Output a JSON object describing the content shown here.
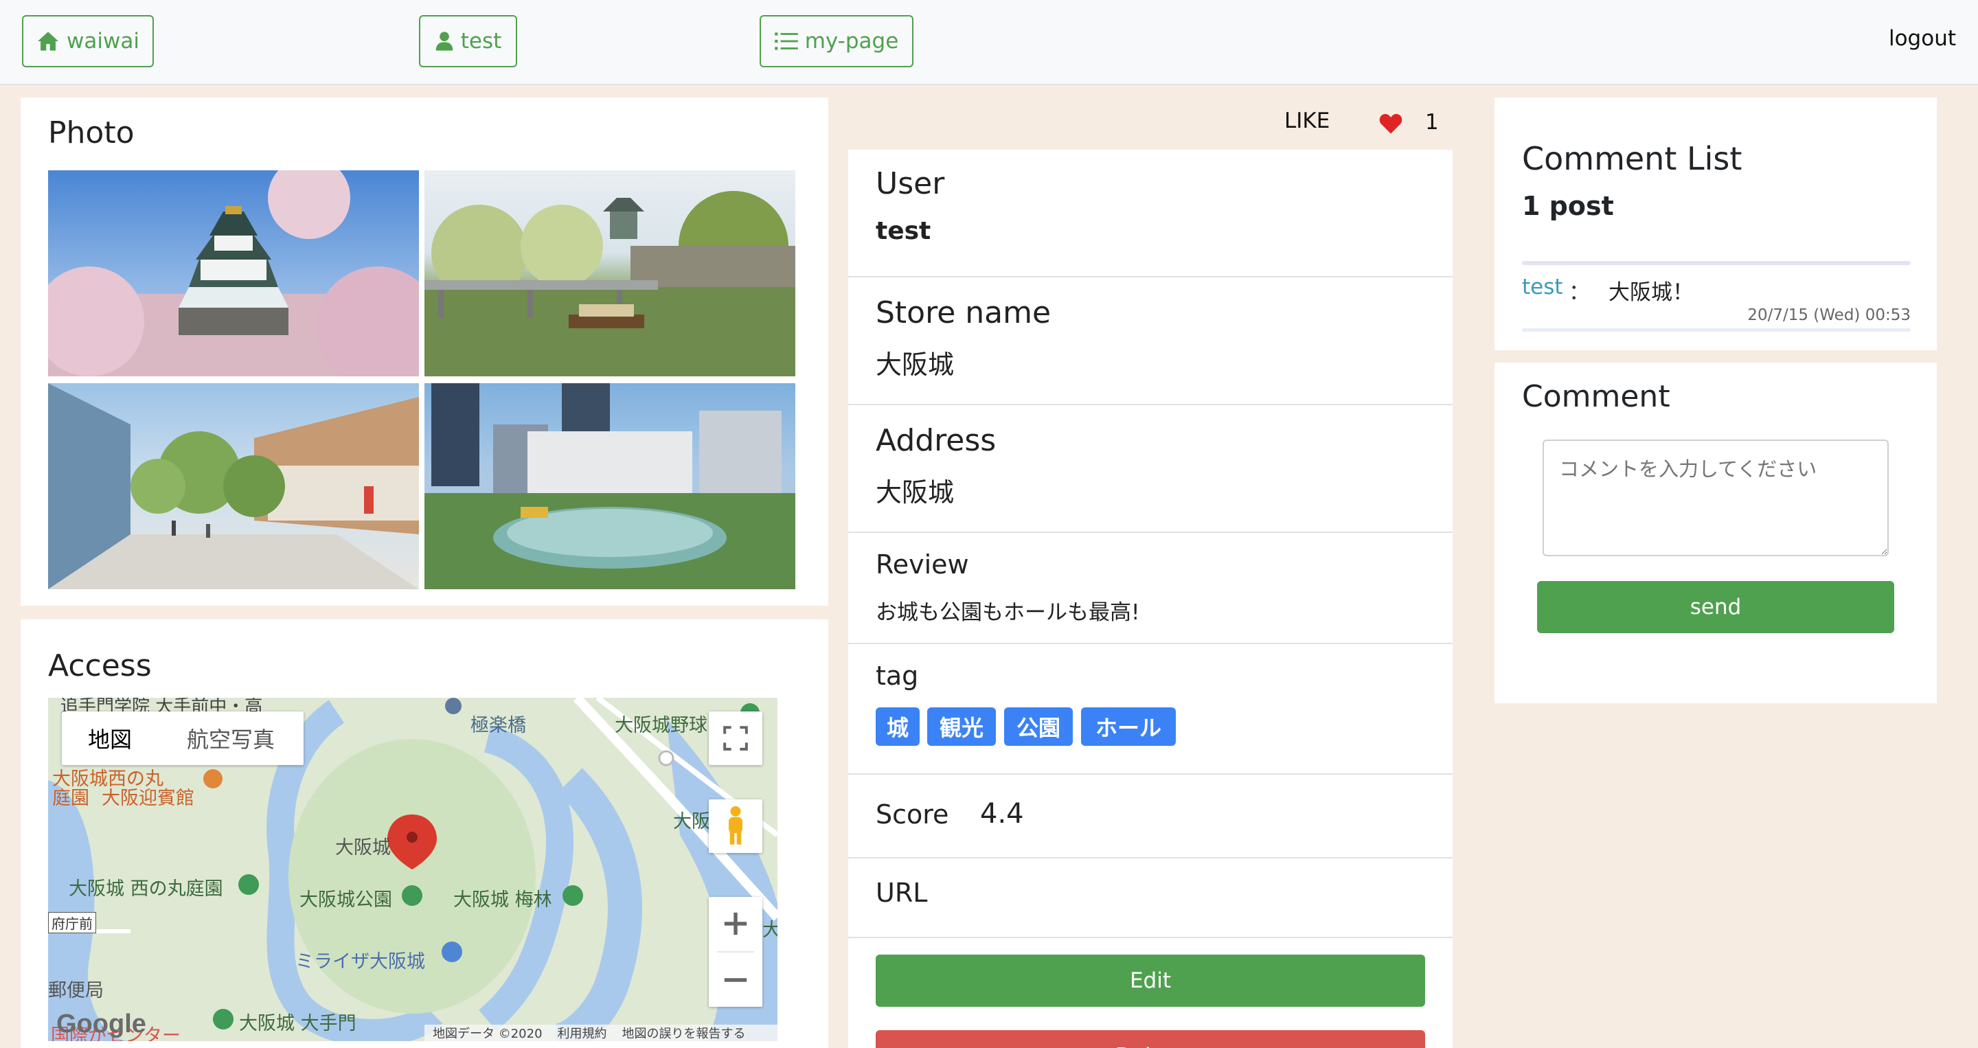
{
  "nav": {
    "home_label": "waiwai",
    "user_label": "test",
    "mypage_label": "my-page",
    "logout_label": "logout"
  },
  "photo": {
    "title": "Photo"
  },
  "access": {
    "title": "Access",
    "map": {
      "tab_map": "地図",
      "tab_aerial": "航空写真",
      "labels": {
        "gokuraku": "極楽橋",
        "yakyu": "大阪城野球",
        "nishinomaru_garden_1": "大阪城西の丸",
        "nishinomaru_garden_2": "庭園",
        "geihinkan": "大阪迎賓館",
        "osakajo": "大阪城",
        "nishinomaru_teien": "大阪城 西の丸庭園",
        "koen": "大阪城公園",
        "bairin": "大阪城 梅林",
        "miraiza": "ミライザ大阪城",
        "otemon": "大阪城 大手門",
        "yuubin": "郵便局",
        "top": "追手門学院 大手前中・高",
        "osaka_right": "大阪",
        "fu_cho": "府庁前",
        "kokusai": "国際がセンター",
        "ote": "大"
      },
      "google": "Google",
      "footer_data": "地図データ ©2020",
      "footer_terms": "利用規約",
      "footer_report": "地図の誤りを報告する"
    }
  },
  "like": {
    "label": "LIKE",
    "count": "1"
  },
  "details": {
    "user_label": "User",
    "user_value": "test",
    "store_label": "Store name",
    "store_value": "大阪城",
    "address_label": "Address",
    "address_value": "大阪城",
    "review_label": "Review",
    "review_value": "お城も公園もホールも最高!",
    "tag_label": "tag",
    "tags": [
      "城",
      "観光",
      "公園",
      "ホール"
    ],
    "score_label": "Score",
    "score_value": "4.4",
    "url_label": "URL",
    "edit_label": "Edit",
    "delete_label": "Delete"
  },
  "comments": {
    "title": "Comment List",
    "count": "1 post",
    "items": [
      {
        "user": "test",
        "sep": "：",
        "text": "大阪城！",
        "time": "20/7/15 (Wed) 00:53"
      }
    ]
  },
  "comment_form": {
    "title": "Comment",
    "placeholder": "コメントを入力してください",
    "send_label": "send"
  },
  "colors": {
    "accent_green": "#4fa14f",
    "tag_blue": "#3b82f6",
    "danger_red": "#d9534f",
    "link_teal": "#3a9bb5",
    "heart_red": "#e02424",
    "background": "#f7ece2"
  }
}
